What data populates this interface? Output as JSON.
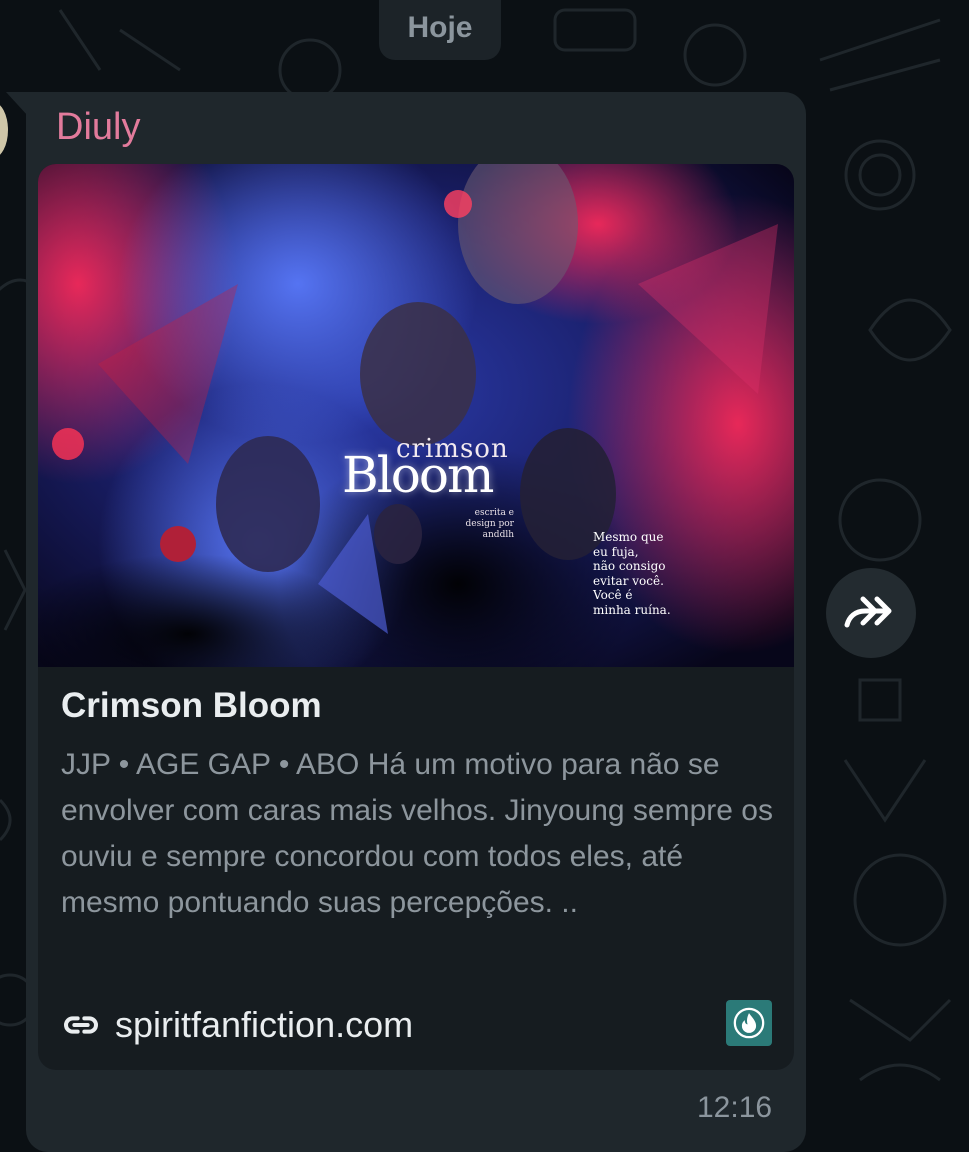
{
  "date_chip": {
    "label": "Hoje"
  },
  "message": {
    "sender": "Diuly",
    "time": "12:16",
    "link_preview": {
      "artwork": {
        "title_small": "crimson",
        "title_big": "Bloom",
        "credit_lines": [
          "escrita e",
          "design por",
          "anddlh"
        ],
        "quote_lines": [
          "Mesmo que",
          "eu fuja,",
          "não consigo",
          "evitar você.",
          "Você é",
          "minha ruína."
        ]
      },
      "title": "Crimson Bloom",
      "description": "JJP • AGE GAP • ABO Há um motivo para não se envolver com caras mais velhos. Jinyoung sempre os ouviu e sempre concordou com todos eles, até mesmo pontuando suas percepções. ..",
      "domain": "spiritfanfiction.com",
      "favicon": "flame-icon"
    }
  },
  "icons": {
    "link": "link-icon",
    "forward": "forward-icon"
  },
  "colors": {
    "background": "#0b1014",
    "bubble": "#1f272c",
    "card": "#161c20",
    "sender": "#e27b9c",
    "muted": "#8b959d",
    "favicon": "#2b7a78"
  }
}
